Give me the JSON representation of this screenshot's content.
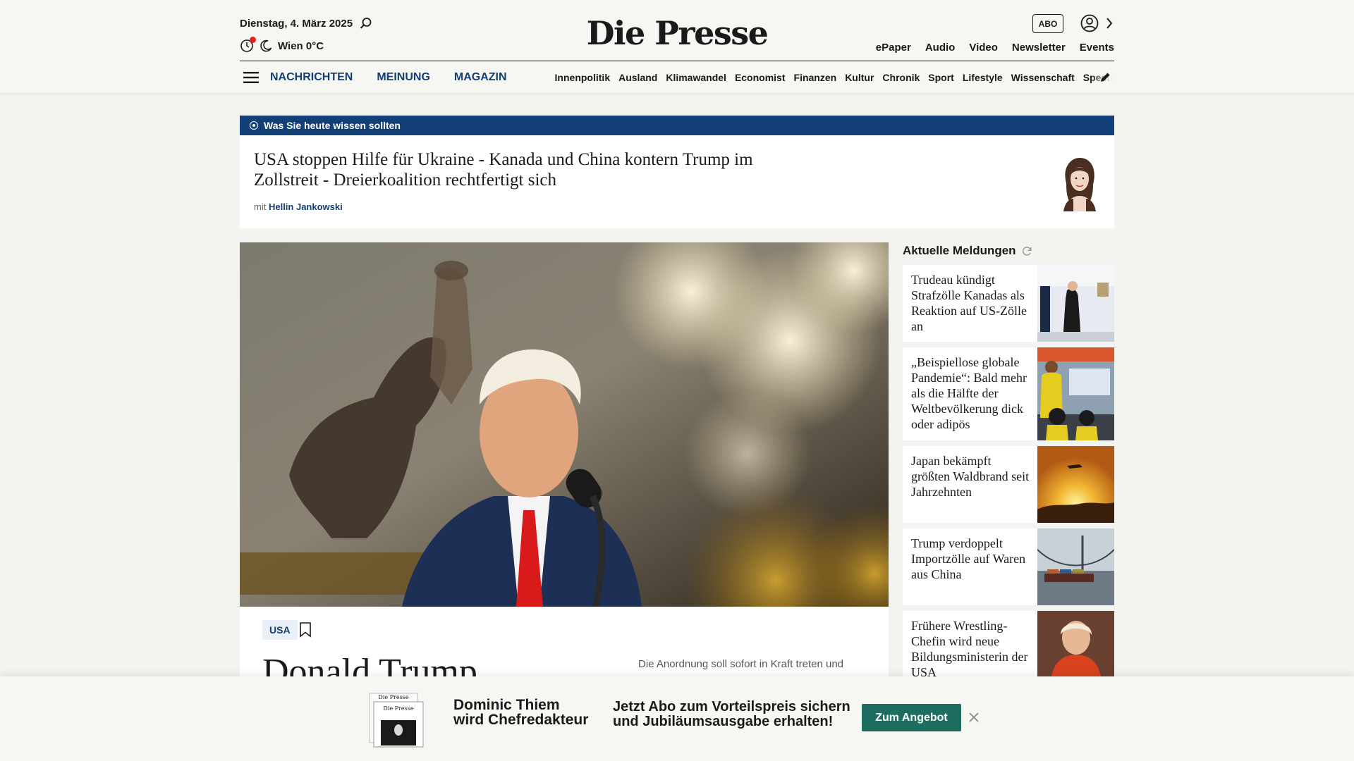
{
  "header": {
    "date": "Dienstag, 4. März 2025",
    "weather": "Wien 0°C",
    "logo": "Die Presse",
    "abo_label": "ABO",
    "service_links": [
      "ePaper",
      "Audio",
      "Video",
      "Newsletter",
      "Events"
    ],
    "sections": [
      "NACHRICHTEN",
      "MEINUNG",
      "MAGAZIN"
    ],
    "ressorts": [
      "Innenpolitik",
      "Ausland",
      "Klimawandel",
      "Economist",
      "Finanzen",
      "Kultur",
      "Chronik",
      "Sport",
      "Lifestyle",
      "Wissenschaft",
      "Spectrum"
    ]
  },
  "briefing": {
    "label": "Was Sie heute wissen sollten",
    "title": "USA stoppen Hilfe für Ukraine - Kanada und China kontern Trump im Zollstreit - Dreierkoalition rechtfertigt sich",
    "author_prefix": "mit",
    "author": "Hellin Jankowski"
  },
  "lead": {
    "tag": "USA",
    "title": "Donald Trump",
    "teaser": "Die Anordnung soll sofort in Kraft treten und"
  },
  "side": {
    "heading": "Aktuelle Meldungen",
    "items": [
      "Trudeau kündigt Strafzölle Kanadas als Reaktion auf US-Zölle an",
      "„Beispiellose globale Pandemie“: Bald mehr als die Hälfte der Weltbevölkerung dick oder adipös",
      "Japan bekämpft größten Waldbrand seit Jahrzehnten",
      "Trump verdoppelt Importzölle auf Waren aus China",
      "Frühere Wrestling-Chefin wird neue Bildungsministerin der USA"
    ]
  },
  "offer": {
    "name_line1": "Dominic Thiem",
    "name_line2": "wird Chefredakteur",
    "pitch_line1": "Jetzt Abo zum Vorteilspreis sichern",
    "pitch_line2": "und Jubiläumsausgabe erhalten!",
    "button": "Zum Angebot",
    "mini_logo": "Die Presse"
  },
  "colors": {
    "brand_blue": "#123f75",
    "offer_green": "#1d6e60",
    "alert_red": "#e3202b"
  }
}
